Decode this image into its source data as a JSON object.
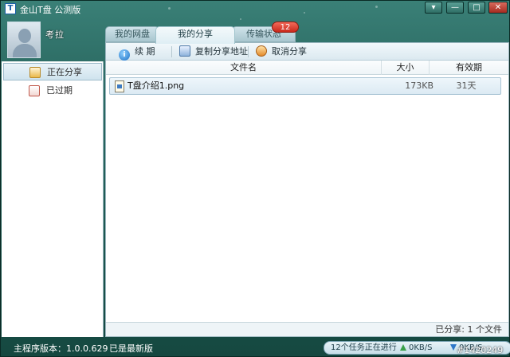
{
  "window": {
    "title": "金山T盘 公测版",
    "logo_text": "T",
    "controls": {
      "menu": "▾",
      "minimize": "—",
      "maximize": "□",
      "close": "✕"
    }
  },
  "user": {
    "name": "考拉"
  },
  "tabs": [
    {
      "label": "我的网盘"
    },
    {
      "label": "我的分享"
    },
    {
      "label": "传输状态"
    }
  ],
  "transfer_badge": "12",
  "sidebar": {
    "items": [
      {
        "label": "正在分享"
      },
      {
        "label": "已过期"
      }
    ]
  },
  "toolbar": {
    "renew_label": "续 期",
    "copy_label": "复制分享地址",
    "cancel_label": "取消分享"
  },
  "table": {
    "headers": {
      "name": "文件名",
      "size": "大小",
      "expire": "有效期"
    },
    "rows": [
      {
        "name": "T盘介绍1.png",
        "size": "173KB",
        "expire": "31天"
      }
    ]
  },
  "share_count_text": "已分享: 1 个文件",
  "statusbar": {
    "version": "主程序版本：1.0.0.629",
    "latest": "已是最新版",
    "tasks": "12个任务正在进行",
    "up_speed": "0KB/S",
    "down_speed": "0KB/S"
  },
  "watermark": "#1420249",
  "colors": {
    "window_bg": "#2e6e66",
    "accent_blue": "#1c6fc4",
    "badge_red": "#c9291b",
    "close_red": "#a52b20"
  }
}
